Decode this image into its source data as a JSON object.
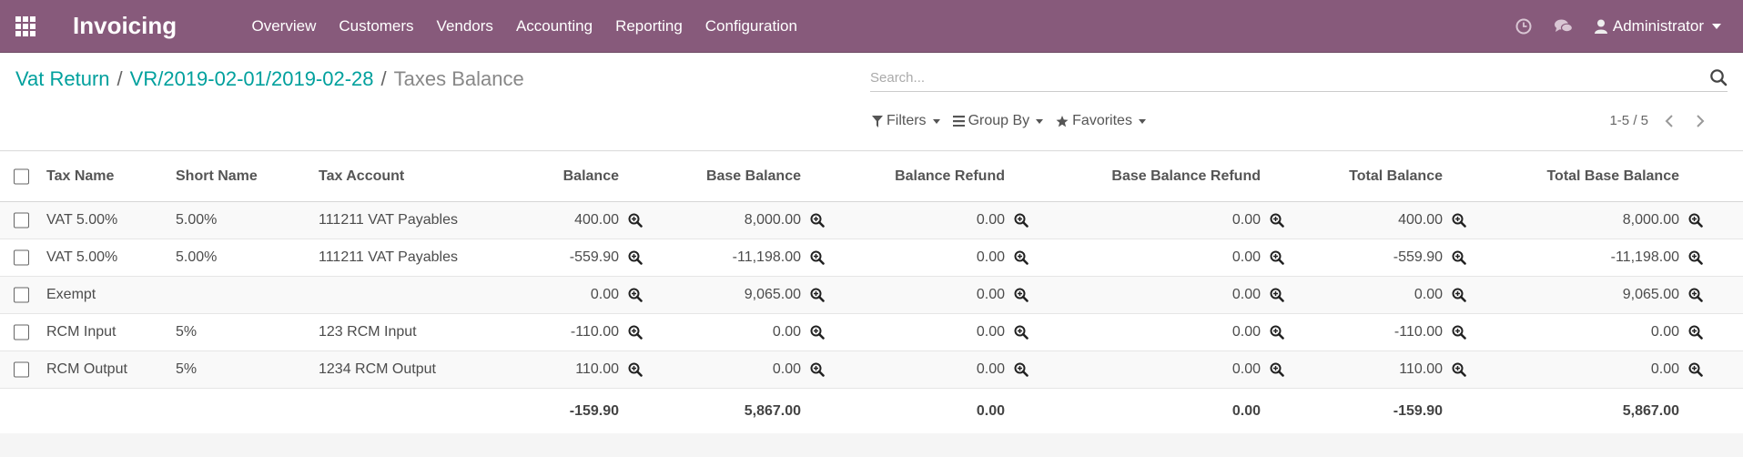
{
  "navbar": {
    "apps_icon": "grid-icon",
    "app_name": "Invoicing",
    "menu": [
      "Overview",
      "Customers",
      "Vendors",
      "Accounting",
      "Reporting",
      "Configuration"
    ],
    "activity_icon": "clock-icon",
    "messages_icon": "chat-icon",
    "user_icon": "user-icon",
    "user": "Administrator",
    "bg_color": "#875a7b"
  },
  "breadcrumb": {
    "items": [
      "Vat Return",
      "VR/2019-02-01/2019-02-28"
    ],
    "separator": "/",
    "current": "Taxes Balance"
  },
  "search": {
    "placeholder": "Search...",
    "value": ""
  },
  "search_options": {
    "filters": "Filters",
    "group_by": "Group By",
    "favorites": "Favorites"
  },
  "pager": {
    "text": "1-5 / 5"
  },
  "table": {
    "columns": [
      "Tax Name",
      "Short Name",
      "Tax Account",
      "Balance",
      "Base Balance",
      "Balance Refund",
      "Base Balance Refund",
      "Total Balance",
      "Total Base Balance"
    ],
    "rows": [
      [
        "VAT 5.00%",
        "5.00%",
        "111211 VAT Payables",
        "400.00",
        "8,000.00",
        "0.00",
        "0.00",
        "400.00",
        "8,000.00"
      ],
      [
        "VAT 5.00%",
        "5.00%",
        "111211 VAT Payables",
        "-559.90",
        "-11,198.00",
        "0.00",
        "0.00",
        "-559.90",
        "-11,198.00"
      ],
      [
        "Exempt",
        "",
        "",
        "0.00",
        "9,065.00",
        "0.00",
        "0.00",
        "0.00",
        "9,065.00"
      ],
      [
        "RCM Input",
        "5%",
        "123 RCM Input",
        "-110.00",
        "0.00",
        "0.00",
        "0.00",
        "-110.00",
        "0.00"
      ],
      [
        "RCM Output",
        "5%",
        "1234 RCM Output",
        "110.00",
        "0.00",
        "0.00",
        "0.00",
        "110.00",
        "0.00"
      ]
    ],
    "totals": [
      "-159.90",
      "5,867.00",
      "0.00",
      "0.00",
      "-159.90",
      "5,867.00"
    ],
    "drill_icon": "zoom-in-icon",
    "accent_color": "#00a09d"
  }
}
